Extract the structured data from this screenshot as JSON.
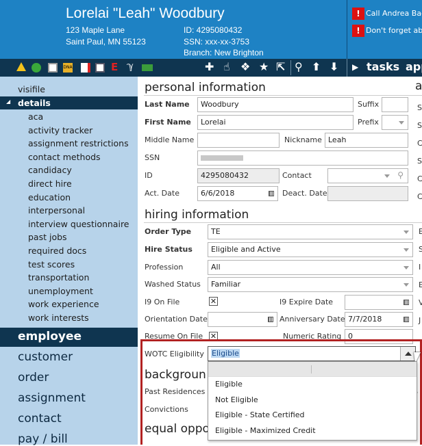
{
  "header": {
    "name": "Lorelai \"Leah\" Woodbury",
    "address1": "123 Maple Lane",
    "address2": "Saint Paul, MN 55123",
    "id": "ID: 4295080432",
    "ssn": "SSN: xxx-xx-3753",
    "branch": "Branch:  New Brighton",
    "alerts": [
      "Call Andrea Bac",
      "Don't forget abo"
    ],
    "alert_glyph": "!"
  },
  "toolbar": {
    "tasks": "tasks",
    "apps": "apps"
  },
  "sidebar": {
    "visifile": "visifile",
    "details": "details",
    "subitems": [
      "aca",
      "activity tracker",
      "assignment restrictions",
      "contact methods",
      "candidacy",
      "direct hire",
      "education",
      "interpersonal",
      "interview questionnaire",
      "past jobs",
      "required docs",
      "test scores",
      "transportation",
      "unemployment",
      "work experience",
      "work interests"
    ],
    "sections": [
      "employee",
      "customer",
      "order",
      "assignment",
      "contact",
      "pay / bill"
    ]
  },
  "personal": {
    "title": "personal information",
    "last_name_label": "Last Name",
    "last_name": "Woodbury",
    "suffix_label": "Suffix",
    "first_name_label": "First Name",
    "first_name": "Lorelai",
    "prefix_label": "Prefix",
    "middle_name_label": "Middle Name",
    "nickname_label": "Nickname",
    "nickname": "Leah",
    "ssn_label": "SSN",
    "id_label": "ID",
    "id_value": "4295080432",
    "contact_label": "Contact",
    "act_date_label": "Act. Date",
    "act_date": "6/6/2018",
    "deact_date_label": "Deact. Date"
  },
  "hiring": {
    "title": "hiring information",
    "order_type_label": "Order Type",
    "order_type": "TE",
    "hire_status_label": "Hire Status",
    "hire_status": "Eligible and Active",
    "profession_label": "Profession",
    "profession": "All",
    "washed_status_label": "Washed Status",
    "washed_status": "Familiar",
    "i9_on_file_label": "I9 On File",
    "i9_expire_label": "I9 Expire Date",
    "orientation_label": "Orientation Date",
    "anniversary_label": "Anniversary Date",
    "anniversary_date": "7/7/2018",
    "resume_label": "Resume On File",
    "numeric_rating_label": "Numeric Rating",
    "numeric_rating": "0",
    "wotc_label": "WOTC Eligibility",
    "wotc_value": "Eligible",
    "wotc_options": [
      "Eligible",
      "Not Eligible",
      "Eligible - State Certified",
      "Eligible - Maximized Credit"
    ]
  },
  "background": {
    "title": "backgroun",
    "past_residences_label": "Past Residences",
    "convictions_label": "Convictions"
  },
  "equal": {
    "title": "equal oppo"
  },
  "right_col": {
    "title_fragment": "a",
    "letters1": [
      "S",
      "S",
      "C",
      "S",
      "C",
      "C"
    ],
    "letters2": [
      "E",
      "S",
      "I",
      "E",
      "V",
      "J"
    ],
    "letter3": "S"
  },
  "checkmark": "✕"
}
